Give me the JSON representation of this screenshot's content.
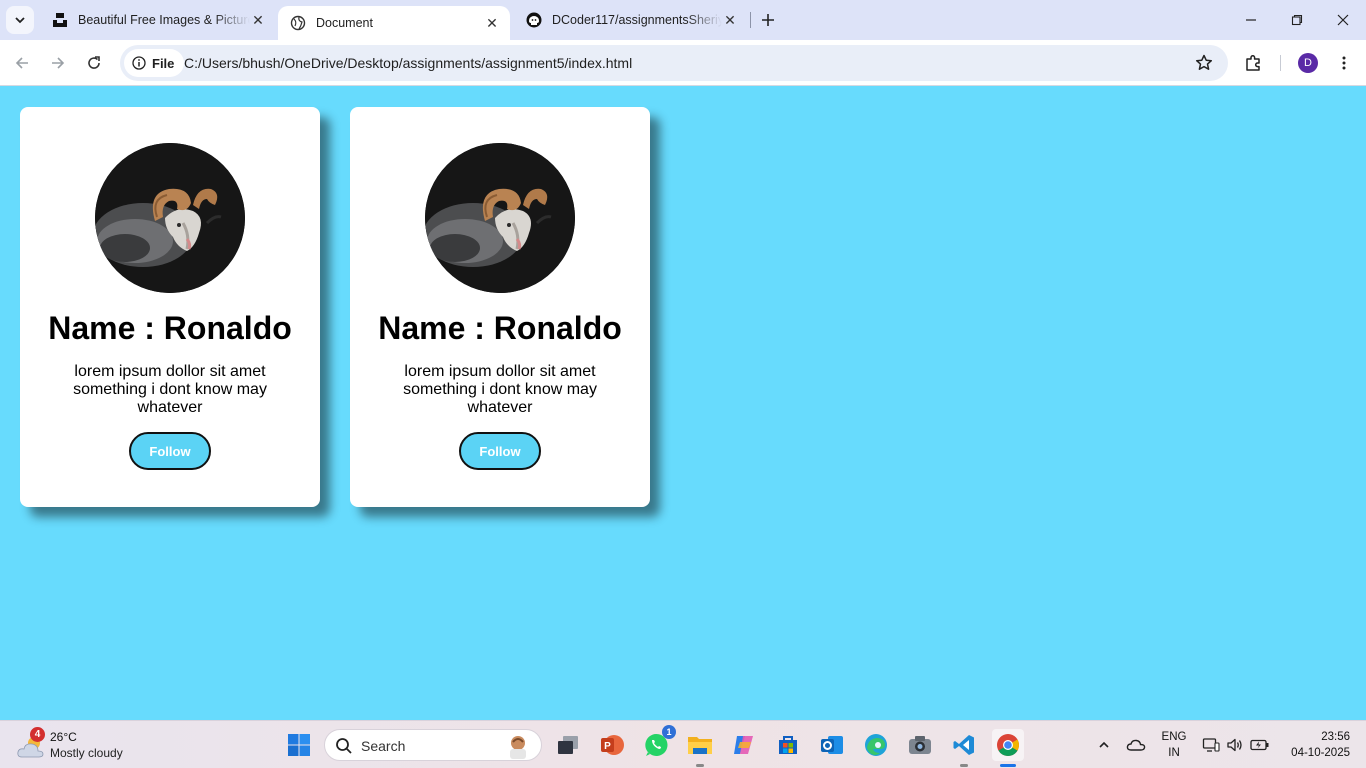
{
  "browser": {
    "tabs": [
      {
        "title": "Beautiful Free Images & Pictures",
        "active": false
      },
      {
        "title": "Document",
        "active": true
      },
      {
        "title": "DCoder117/assignmentsSheriyans",
        "active": false
      }
    ],
    "address": {
      "scheme_label": "File",
      "url": "C:/Users/bhush/OneDrive/Desktop/assignments/assignment5/index.html"
    },
    "profile_initial": "D"
  },
  "page": {
    "background": "#67dbfd",
    "cards": [
      {
        "name": "Name : Ronaldo",
        "description": "lorem ipsum dollor sit amet something i dont know may whatever",
        "button_label": "Follow"
      },
      {
        "name": "Name : Ronaldo",
        "description": "lorem ipsum dollor sit amet something i dont know may whatever",
        "button_label": "Follow"
      }
    ]
  },
  "taskbar": {
    "weather": {
      "badge": "4",
      "temperature": "26°C",
      "condition": "Mostly cloudy"
    },
    "search_placeholder": "Search",
    "whatsapp_badge": "1",
    "language": {
      "line1": "ENG",
      "line2": "IN"
    },
    "clock": {
      "time": "23:56",
      "date": "04-10-2025"
    }
  }
}
